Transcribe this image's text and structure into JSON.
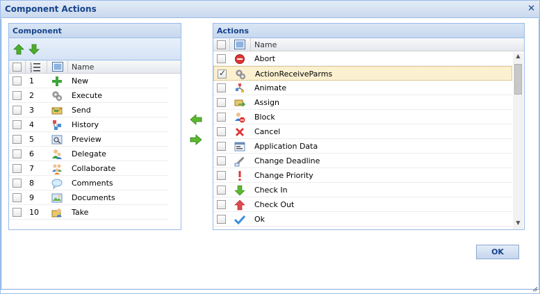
{
  "window": {
    "title": "Component Actions",
    "close_icon": "close-icon",
    "resize_icon": "resize-grip-icon"
  },
  "component_panel": {
    "title": "Component",
    "toolbar": {
      "move_up_icon": "arrow-up-icon",
      "move_down_icon": "arrow-down-icon"
    },
    "columns": {
      "order_icon": "ordered-list-icon",
      "type_icon": "component-icon",
      "name": "Name"
    },
    "rows": [
      {
        "index": "1",
        "name": "New",
        "icon": "plus-icon",
        "checked": false
      },
      {
        "index": "2",
        "name": "Execute",
        "icon": "gears-icon",
        "checked": false
      },
      {
        "index": "3",
        "name": "Send",
        "icon": "envelope-icon",
        "checked": false
      },
      {
        "index": "4",
        "name": "History",
        "icon": "history-icon",
        "checked": false
      },
      {
        "index": "5",
        "name": "Preview",
        "icon": "preview-icon",
        "checked": false
      },
      {
        "index": "6",
        "name": "Delegate",
        "icon": "users-icon",
        "checked": false
      },
      {
        "index": "7",
        "name": "Collaborate",
        "icon": "group-icon",
        "checked": false
      },
      {
        "index": "8",
        "name": "Comments",
        "icon": "comment-icon",
        "checked": false
      },
      {
        "index": "9",
        "name": "Documents",
        "icon": "documents-icon",
        "checked": false
      },
      {
        "index": "10",
        "name": "Take",
        "icon": "take-icon",
        "checked": false
      }
    ]
  },
  "transfer": {
    "left_icon": "arrow-left-icon",
    "right_icon": "arrow-right-icon"
  },
  "actions_panel": {
    "title": "Actions",
    "columns": {
      "type_icon": "component-icon",
      "name": "Name"
    },
    "rows": [
      {
        "name": "Abort",
        "icon": "stop-icon",
        "checked": false,
        "selected": false
      },
      {
        "name": "ActionReceiveParms",
        "icon": "gears-icon",
        "checked": true,
        "selected": true
      },
      {
        "name": "Animate",
        "icon": "animate-icon",
        "checked": false,
        "selected": false
      },
      {
        "name": "Assign",
        "icon": "assign-icon",
        "checked": false,
        "selected": false
      },
      {
        "name": "Block",
        "icon": "block-user-icon",
        "checked": false,
        "selected": false
      },
      {
        "name": "Cancel",
        "icon": "cancel-icon",
        "checked": false,
        "selected": false
      },
      {
        "name": "Application Data",
        "icon": "application-data-icon",
        "checked": false,
        "selected": false
      },
      {
        "name": "Change Deadline",
        "icon": "deadline-icon",
        "checked": false,
        "selected": false
      },
      {
        "name": "Change Priority",
        "icon": "priority-icon",
        "checked": false,
        "selected": false
      },
      {
        "name": "Check In",
        "icon": "check-in-icon",
        "checked": false,
        "selected": false
      },
      {
        "name": "Check Out",
        "icon": "check-out-icon",
        "checked": false,
        "selected": false
      },
      {
        "name": "Ok",
        "icon": "checkmark-icon",
        "checked": false,
        "selected": false
      }
    ]
  },
  "ok_button": "OK"
}
